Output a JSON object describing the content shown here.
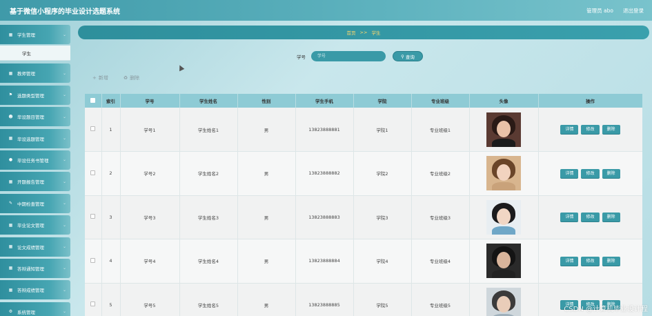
{
  "header": {
    "title": "基于微信小程序的毕业设计选题系统",
    "user": "管理员 abo",
    "logout": "退出登录"
  },
  "sidebar": {
    "items": [
      {
        "label": "学生管理",
        "icon": "grid-icon",
        "expanded": true,
        "sub": [
          "学生"
        ]
      },
      {
        "label": "教师管理",
        "icon": "grid-icon"
      },
      {
        "label": "选题类型管理",
        "icon": "flag-icon"
      },
      {
        "label": "毕设题目管理",
        "icon": "person-icon"
      },
      {
        "label": "毕设选题管理",
        "icon": "grid-icon"
      },
      {
        "label": "毕设任务书管理",
        "icon": "pin-icon"
      },
      {
        "label": "开题报告管理",
        "icon": "grid-icon"
      },
      {
        "label": "中期检查管理",
        "icon": "chat-icon"
      },
      {
        "label": "毕业论文管理",
        "icon": "grid-icon"
      },
      {
        "label": "论文成绩管理",
        "icon": "grid-icon"
      },
      {
        "label": "答辩通知管理",
        "icon": "grid-icon"
      },
      {
        "label": "答辩成绩管理",
        "icon": "grid-icon"
      },
      {
        "label": "系统管理",
        "icon": "gear-icon"
      }
    ]
  },
  "breadcrumb": {
    "home": "首页",
    "sep": ">>",
    "current": "学生"
  },
  "search": {
    "label": "学号",
    "placeholder": "学号",
    "button": "查询"
  },
  "toolbar": {
    "add": "新增",
    "delete": "删除"
  },
  "table": {
    "headers": [
      "索引",
      "学号",
      "学生姓名",
      "性别",
      "学生手机",
      "学院",
      "专业班级",
      "头像",
      "操作"
    ],
    "row_buttons": [
      "详情",
      "修改",
      "删除"
    ],
    "rows": [
      {
        "idx": "1",
        "xh": "学号1",
        "name": "学生姓名1",
        "sex": "男",
        "phone": "13823888881",
        "college": "学院1",
        "cls": "专业班级1"
      },
      {
        "idx": "2",
        "xh": "学号2",
        "name": "学生姓名2",
        "sex": "男",
        "phone": "13823888882",
        "college": "学院2",
        "cls": "专业班级2"
      },
      {
        "idx": "3",
        "xh": "学号3",
        "name": "学生姓名3",
        "sex": "男",
        "phone": "13823888883",
        "college": "学院3",
        "cls": "专业班级3"
      },
      {
        "idx": "4",
        "xh": "学号4",
        "name": "学生姓名4",
        "sex": "男",
        "phone": "13823888884",
        "college": "学院4",
        "cls": "专业班级4"
      },
      {
        "idx": "5",
        "xh": "学号5",
        "name": "学生姓名5",
        "sex": "男",
        "phone": "13823888885",
        "college": "学院5",
        "cls": "专业班级5"
      }
    ]
  },
  "watermark": "CSDN @计算机毕业设计程",
  "colors": {
    "accent": "#3a9aa7",
    "header": "#8ecbd5"
  }
}
